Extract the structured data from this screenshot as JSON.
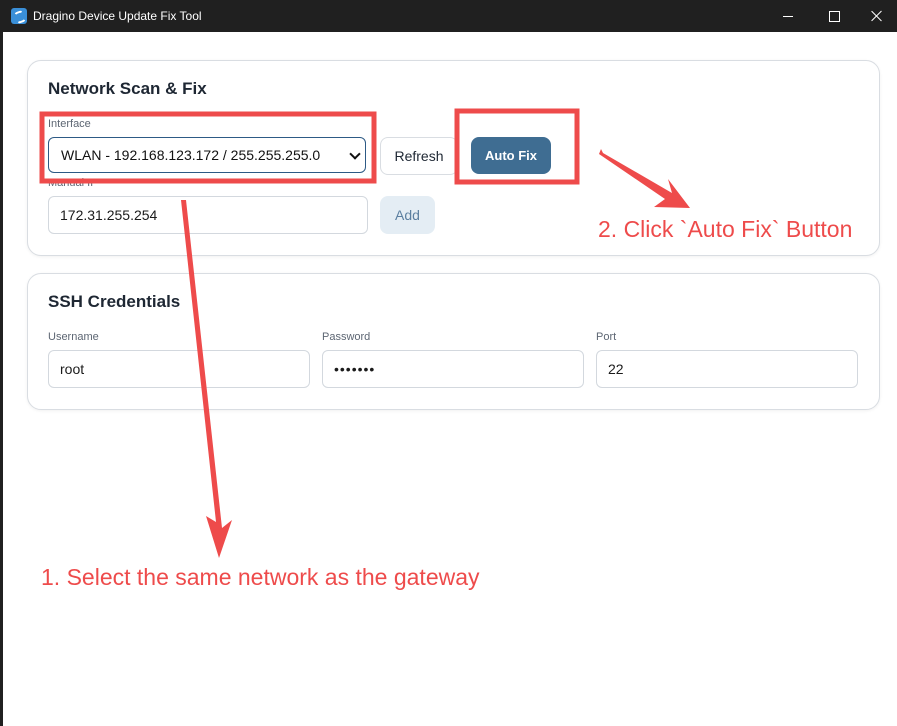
{
  "window": {
    "title": "Dragino Device Update Fix Tool",
    "icon": "dragino-app-icon",
    "controls": [
      "minimize-icon",
      "maximize-icon",
      "close-icon"
    ]
  },
  "network_card": {
    "title": "Network Scan & Fix",
    "interface_label": "Interface",
    "interface_selected": "WLAN - 192.168.123.172 / 255.255.255.0",
    "refresh_label": "Refresh",
    "autofix_label": "Auto Fix",
    "manual_ip_label": "Manual IP",
    "manual_ip_value": "172.31.255.254",
    "add_label": "Add"
  },
  "ssh_card": {
    "title": "SSH Credentials",
    "username_label": "Username",
    "username_value": "root",
    "password_label": "Password",
    "password_value": "•••••••",
    "port_label": "Port",
    "port_value": "22"
  },
  "annotations": {
    "step1": "1. Select the same network as the gateway",
    "step2": "2. Click `Auto Fix` Button",
    "color": "#ee4b4b"
  },
  "colors": {
    "titlebar": "#202020",
    "primary_button": "#3f6d92",
    "secondary_button": "#e4edf4",
    "select_border": "#2d5a85"
  }
}
